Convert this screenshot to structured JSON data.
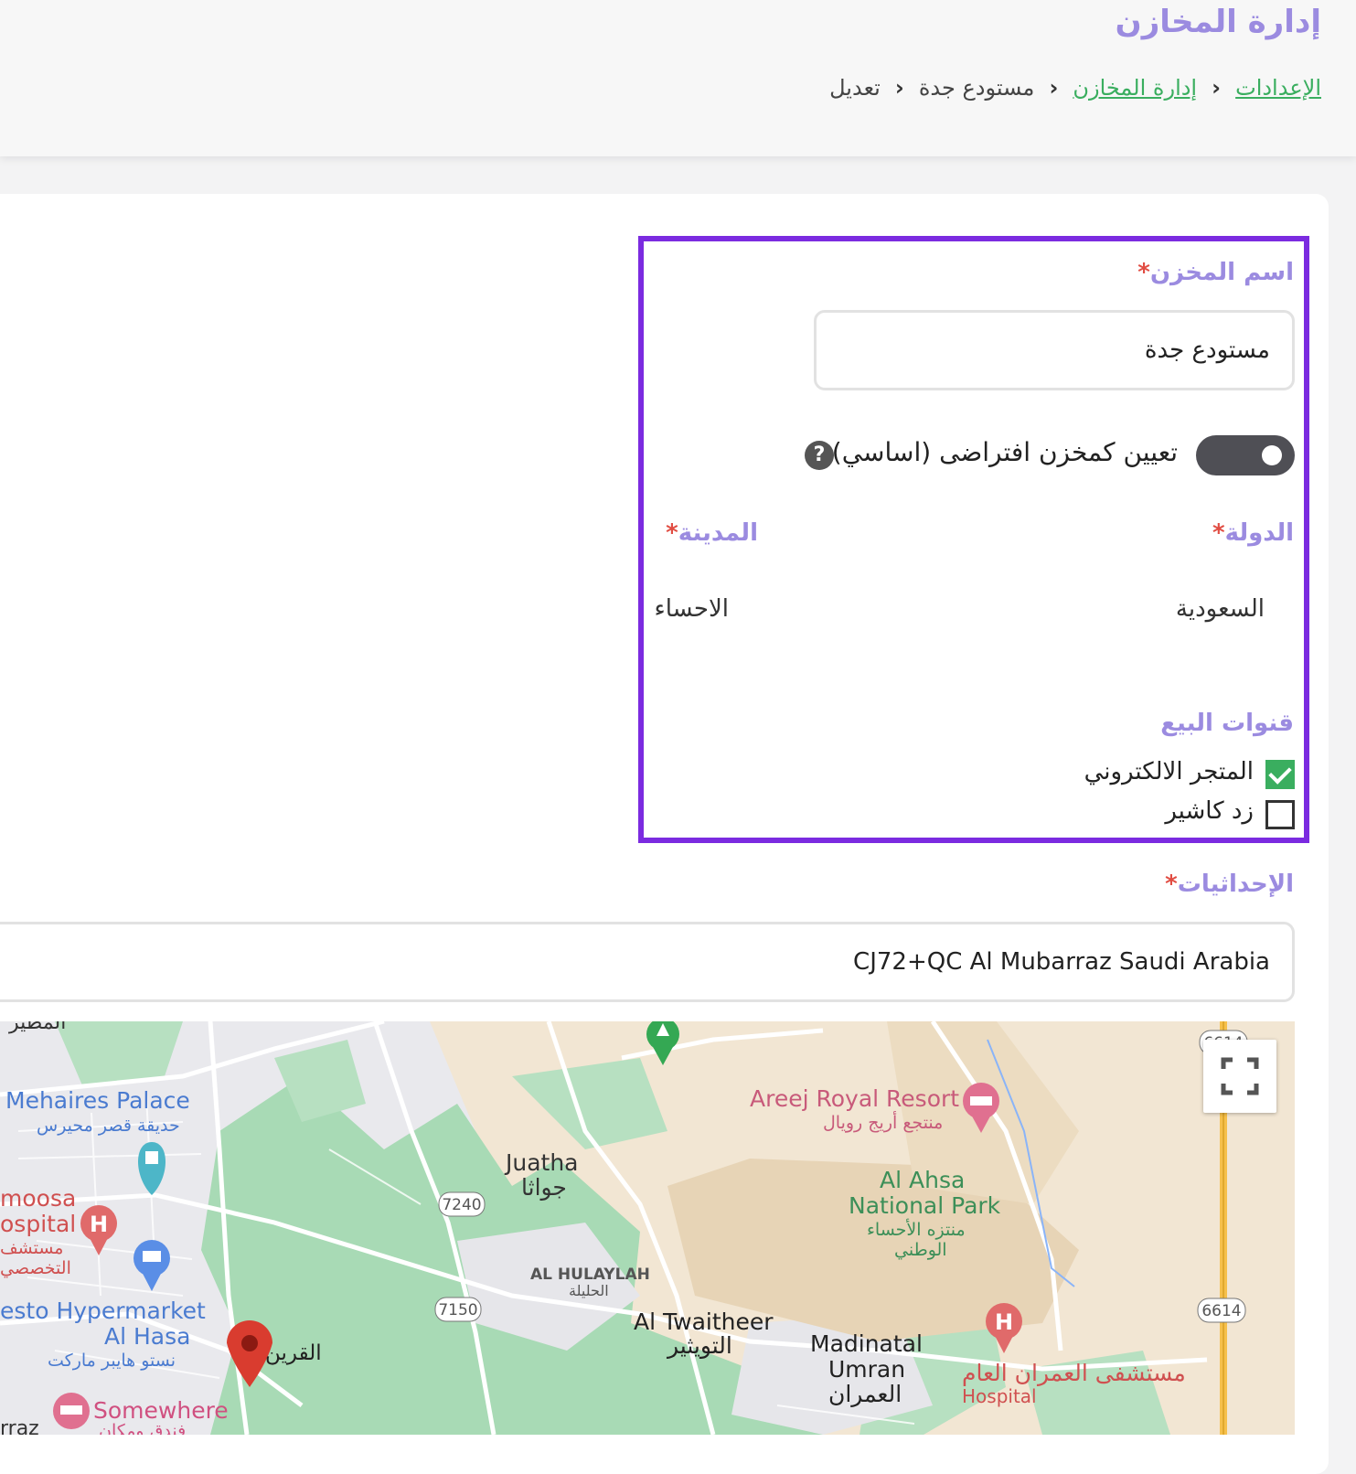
{
  "header": {
    "title": "إدارة المخازن",
    "breadcrumb": {
      "settings": "الإعدادات",
      "warehouses": "إدارة المخازن",
      "current": "مستودع جدة",
      "edit": "تعديل"
    }
  },
  "form": {
    "name_label": "اسم المخزن",
    "required_mark": "*",
    "name_value": "مستودع جدة",
    "default_label": "تعيين كمخزن افتراضى (اساسي)",
    "default_enabled": true,
    "help_glyph": "?",
    "country_label": "الدولة",
    "country_value": "السعودية",
    "city_label": "المدينة",
    "city_value": "الاحساء",
    "channels_label": "قنوات البيع",
    "channels": [
      {
        "label": "المتجر الالكتروني",
        "checked": true
      },
      {
        "label": "زد كاشير",
        "checked": false
      }
    ],
    "coords_label": "الإحداثيات",
    "coords_value": "CJ72+QC Al Mubarraz Saudi Arabia"
  },
  "map": {
    "labels": {
      "top_left": "المطير",
      "mehaires_en": "Mehaires Palace",
      "mehaires_ar": "حديقة قصر محيرس",
      "moosa_en": "moosa",
      "hospital_en": "ospital",
      "moosa_ar1": "مستشف",
      "moosa_ar2": "التخصصي",
      "hyper_en1": "esto Hypermarket",
      "hyper_en2": "Al Hasa",
      "hyper_ar": "نستو هايبر ماركت",
      "alqurain": "القرين",
      "somewhere": "Somewhere",
      "somewhere_ar": "فندق ومكان",
      "raz": "rraz",
      "juatha_en": "Juatha",
      "juatha_ar": "جواثا",
      "r7240": "7240",
      "r7150": "7150",
      "hulaylah_en": "AL HULAYLAH",
      "hulaylah_ar": "الحليلة",
      "twaitheer_en": "Al Twaitheer",
      "twaitheer_ar": "التويثير",
      "umran_en1": "Madinatal",
      "umran_en2": "Umran",
      "umran_ar": "العمران",
      "areej_en": "Areej Royal Resort",
      "areej_ar": "منتجع أريج رويال",
      "park_en1": "Al Ahsa",
      "park_en2": "National Park",
      "park_ar1": "منتزه الأحساء",
      "park_ar2": "الوطني",
      "hosp_ar": "مستشفى العمران العام",
      "hosp_en": "Hospital",
      "r6614": "6614",
      "r6614_top": "6614"
    },
    "colors": {
      "land": "#f2e6d3",
      "green": "#a8dab5",
      "urban": "#e8e8ec",
      "road": "#ffffff",
      "highway": "#f6c04b",
      "poi_red": "#e06a6a",
      "poi_blue": "#5a8ee6",
      "poi_green": "#34a853",
      "marker": "#d93c2f"
    }
  },
  "colors": {
    "accent": "#7b2be0",
    "title": "#9b8be0",
    "link": "#3aae5f",
    "required": "#e14d43"
  },
  "icons": {
    "breadcrumb_separator": "chevron-left-icon",
    "help": "question-circle-icon",
    "fullscreen": "fullscreen-icon",
    "map_marker": "map-pin-icon"
  }
}
